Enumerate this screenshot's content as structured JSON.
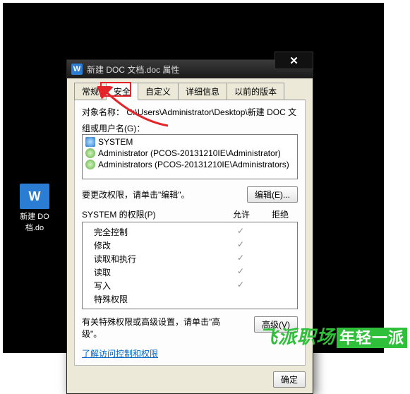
{
  "desktop_file": {
    "label1": "新建 DO",
    "label2": "档.do"
  },
  "dialog": {
    "title": "新建 DOC 文档.doc 属性",
    "tabs": [
      "常规",
      "安全",
      "自定义",
      "详细信息",
      "以前的版本"
    ],
    "active_tab": 1,
    "object_label": "对象名称：",
    "object_value": "C:\\Users\\Administrator\\Desktop\\新建 DOC 文",
    "group_label": "组或用户名(G)：",
    "groups": [
      {
        "icon": "sys",
        "text": "SYSTEM"
      },
      {
        "icon": "usr",
        "text": "Administrator (PCOS-20131210IE\\Administrator)"
      },
      {
        "icon": "usr",
        "text": "Administrators (PCOS-20131210IE\\Administrators)"
      }
    ],
    "edit_hint": "要更改权限，请单击\"编辑\"。",
    "edit_btn": "编辑(E)...",
    "perm_header": "SYSTEM 的权限(P)",
    "allow_label": "允许",
    "deny_label": "拒绝",
    "perms": [
      {
        "name": "完全控制",
        "allow": true
      },
      {
        "name": "修改",
        "allow": true
      },
      {
        "name": "读取和执行",
        "allow": true
      },
      {
        "name": "读取",
        "allow": true
      },
      {
        "name": "写入",
        "allow": true
      },
      {
        "name": "特殊权限",
        "allow": false
      }
    ],
    "adv_hint": "有关特殊权限或高级设置，请单击\"高级\"。",
    "adv_btn": "高级(V)",
    "learn_link": "了解访问控制和权限",
    "ok_btn": "确定"
  },
  "watermark": {
    "brand": "飞派职场",
    "sub": "年轻一派"
  }
}
